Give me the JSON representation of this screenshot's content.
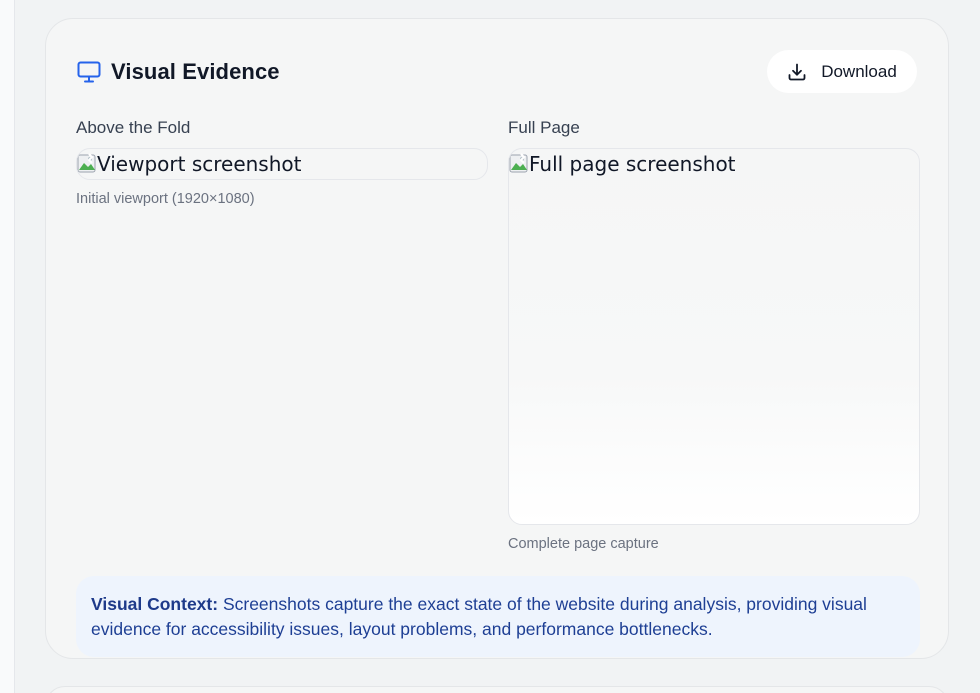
{
  "card": {
    "title": "Visual Evidence",
    "title_icon": "monitor-icon",
    "download_label": "Download",
    "download_icon": "download-icon"
  },
  "columns": {
    "left": {
      "label": "Above the Fold",
      "image_alt": "Viewport screenshot",
      "caption": "Initial viewport (1920×1080)"
    },
    "right": {
      "label": "Full Page",
      "image_alt": "Full page screenshot",
      "caption": "Complete page capture"
    }
  },
  "context": {
    "label": "Visual Context:",
    "text": "Screenshots capture the exact state of the website during analysis, providing visual evidence for accessibility issues, layout problems, and performance bottlenecks."
  },
  "colors": {
    "accent": "#2563eb",
    "context_bg": "#eef4fd",
    "context_text": "#1e3a8a"
  }
}
